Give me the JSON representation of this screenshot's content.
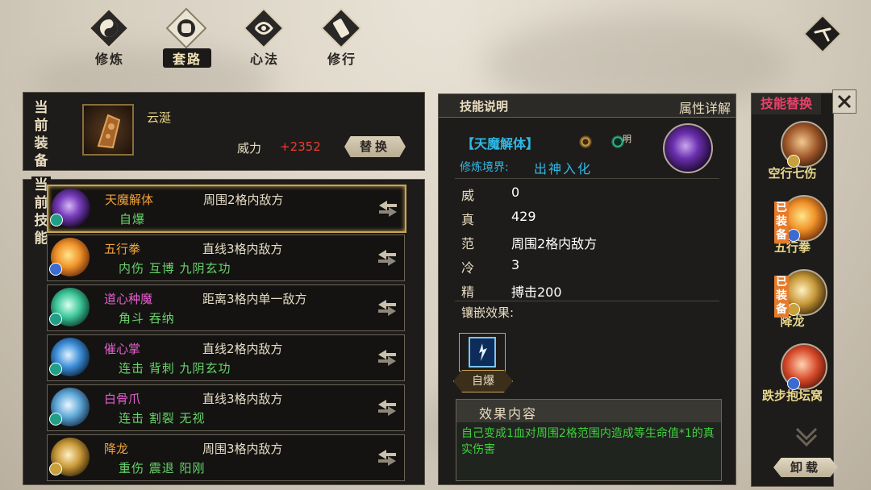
{
  "tabs": [
    {
      "label": "修炼",
      "icon": "yin-yang-emblem"
    },
    {
      "label": "套路",
      "icon": "fist-emblem",
      "active": true
    },
    {
      "label": "心法",
      "icon": "swirl-emblem"
    },
    {
      "label": "修行",
      "icon": "scroll-emblem"
    }
  ],
  "equip": {
    "section_label": "当前装备",
    "item_name": "云涎",
    "power_label": "威力",
    "power_value": "+2352",
    "replace_label": "替换"
  },
  "skills": {
    "section_label": "当前技能",
    "rows": [
      {
        "name": "天魔解体",
        "range": "周围2格内敌方",
        "tags": "自爆",
        "badge": "明",
        "name_color": "#f2a23a",
        "icon": "purple-vortex-icon"
      },
      {
        "name": "五行拳",
        "range": "直线3格内敌方",
        "tags": "内伤 互博 九阴玄功",
        "badge": "阴",
        "name_color": "#f2a23a",
        "icon": "fire-fist-icon"
      },
      {
        "name": "道心种魔",
        "range": "距离3格内单一敌方",
        "tags": "角斗 吞纳",
        "badge": "明",
        "name_color": "#e85fd1",
        "icon": "green-spirit-icon"
      },
      {
        "name": "催心掌",
        "range": "直线2格内敌方",
        "tags": "连击 背刺 九阴玄功",
        "badge": "明",
        "name_color": "#e85fd1",
        "icon": "blue-palm-icon"
      },
      {
        "name": "白骨爪",
        "range": "直线3格内敌方",
        "tags": "连击 割裂 无视",
        "badge": "明",
        "name_color": "#e85fd1",
        "icon": "bone-claw-icon"
      },
      {
        "name": "降龙",
        "range": "周围3格内敌方",
        "tags": "重伤 震退 阳刚",
        "badge": "阳",
        "name_color": "#f2a23a",
        "icon": "golden-dragon-icon"
      }
    ]
  },
  "detail": {
    "tab_title": "技能说明",
    "tab_attr": "属性详解",
    "skill_title": "【天魔解体】",
    "small_badges": [
      "阴",
      "明"
    ],
    "realm_label": "修炼境界:",
    "realm_value": "出神入化",
    "stats": [
      {
        "label": "威",
        "value": "0"
      },
      {
        "label": "真",
        "value": "429"
      },
      {
        "label": "范",
        "value": "周围2格内敌方"
      },
      {
        "label": "冷",
        "value": "3"
      },
      {
        "label": "精",
        "value": "搏击200"
      }
    ],
    "inlay_label": "镶嵌效果:",
    "inlay_name": "自爆",
    "effect_title": "效果内容",
    "effect_text": "自己变成1血对周围2格范围内造成等生命值*1的真实伤害"
  },
  "replace_panel": {
    "title": "技能替换",
    "items": [
      {
        "name": "空行七伤",
        "equipped": false,
        "badge": "阳"
      },
      {
        "name": "五行拳",
        "equipped": true,
        "badge": "阴"
      },
      {
        "name": "降龙",
        "equipped": true,
        "badge": "阳"
      },
      {
        "name": "跌步抱坛窝",
        "equipped": false,
        "badge": "阴"
      }
    ],
    "equipped_label": "已装备",
    "unload_label": "卸载"
  }
}
